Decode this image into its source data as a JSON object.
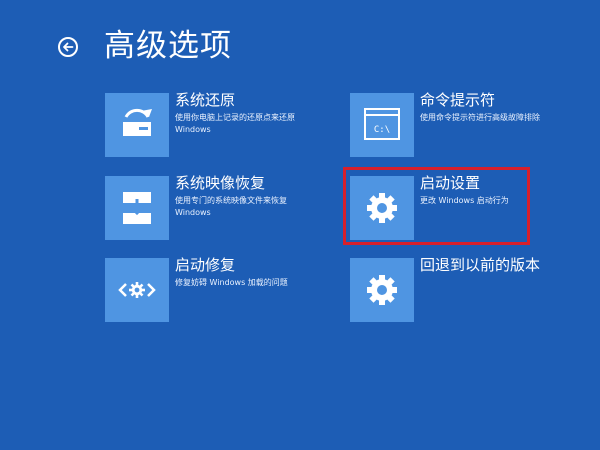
{
  "header": {
    "back_label": "←",
    "title": "高级选项"
  },
  "options": [
    {
      "id": "system-restore",
      "icon": "system-restore-icon",
      "title": "系统还原",
      "description": "使用你电脑上记录的还原点来还原 Windows"
    },
    {
      "id": "system-image-recovery",
      "icon": "system-image-recovery-icon",
      "title": "系统映像恢复",
      "description": "使用专门的系统映像文件来恢复 Windows"
    },
    {
      "id": "startup-repair",
      "icon": "startup-repair-icon",
      "title": "启动修复",
      "description": "修复妨碍 Windows 加载的问题"
    },
    {
      "id": "command-prompt",
      "icon": "command-prompt-icon",
      "title": "命令提示符",
      "description": "使用命令提示符进行高级故障排除",
      "icon_text": "C:\\"
    },
    {
      "id": "startup-settings",
      "icon": "gear-icon",
      "title": "启动设置",
      "description": "更改 Windows 启动行为",
      "highlighted": true,
      "highlight_color": "#d8202b"
    },
    {
      "id": "go-back-previous-version",
      "icon": "gear-icon",
      "title": "回退到以前的版本",
      "description": ""
    }
  ],
  "colors": {
    "background": "#1d5db5",
    "tile": "#4f95e2",
    "text": "#ffffff",
    "highlight": "#d8202b"
  }
}
